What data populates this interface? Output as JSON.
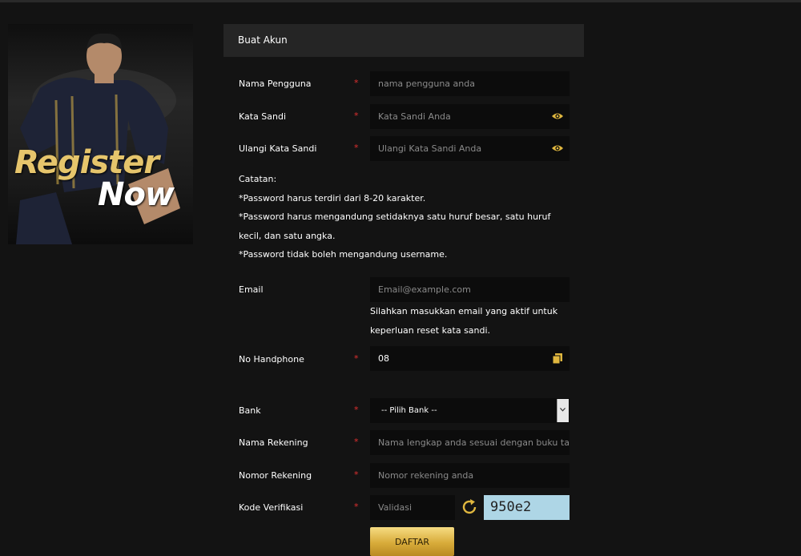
{
  "banner": {
    "word1": "Register",
    "word2": "Now"
  },
  "form": {
    "title": "Buat Akun",
    "required_mark": "*",
    "username": {
      "label": "Nama Pengguna",
      "placeholder": "nama pengguna anda"
    },
    "password": {
      "label": "Kata Sandi",
      "placeholder": "Kata Sandi Anda"
    },
    "confirm_password": {
      "label": "Ulangi Kata Sandi",
      "placeholder": "Ulangi Kata Sandi Anda"
    },
    "notes": [
      "Catatan:",
      "*Password harus terdiri dari 8-20 karakter.",
      "*Password harus mengandung setidaknya satu huruf besar, satu huruf kecil, dan satu angka.",
      "*Password tidak boleh mengandung username."
    ],
    "email": {
      "label": "Email",
      "placeholder": "Email@example.com",
      "help": "Silahkan masukkan email yang aktif untuk keperluan reset kata sandi."
    },
    "phone": {
      "label": "No Handphone",
      "value": "08"
    },
    "bank": {
      "label": "Bank",
      "selected": "-- Pilih Bank --"
    },
    "account_name": {
      "label": "Nama Rekening",
      "placeholder": "Nama lengkap anda sesuai dengan buku tabungan"
    },
    "account_number": {
      "label": "Nomor Rekening",
      "placeholder": "Nomor rekening anda"
    },
    "verification": {
      "label": "Kode Verifikasi",
      "placeholder": "Validasi",
      "captcha": "950e2"
    },
    "submit_label": "DAFTAR"
  },
  "colors": {
    "accent": "#e0b73f",
    "required": "#e03030",
    "captcha_bg": "#aed6e6"
  },
  "icons": {
    "password_toggle": "eye-icon",
    "paste": "copy-icon",
    "refresh": "refresh-icon",
    "dropdown": "chevron-down-icon"
  }
}
